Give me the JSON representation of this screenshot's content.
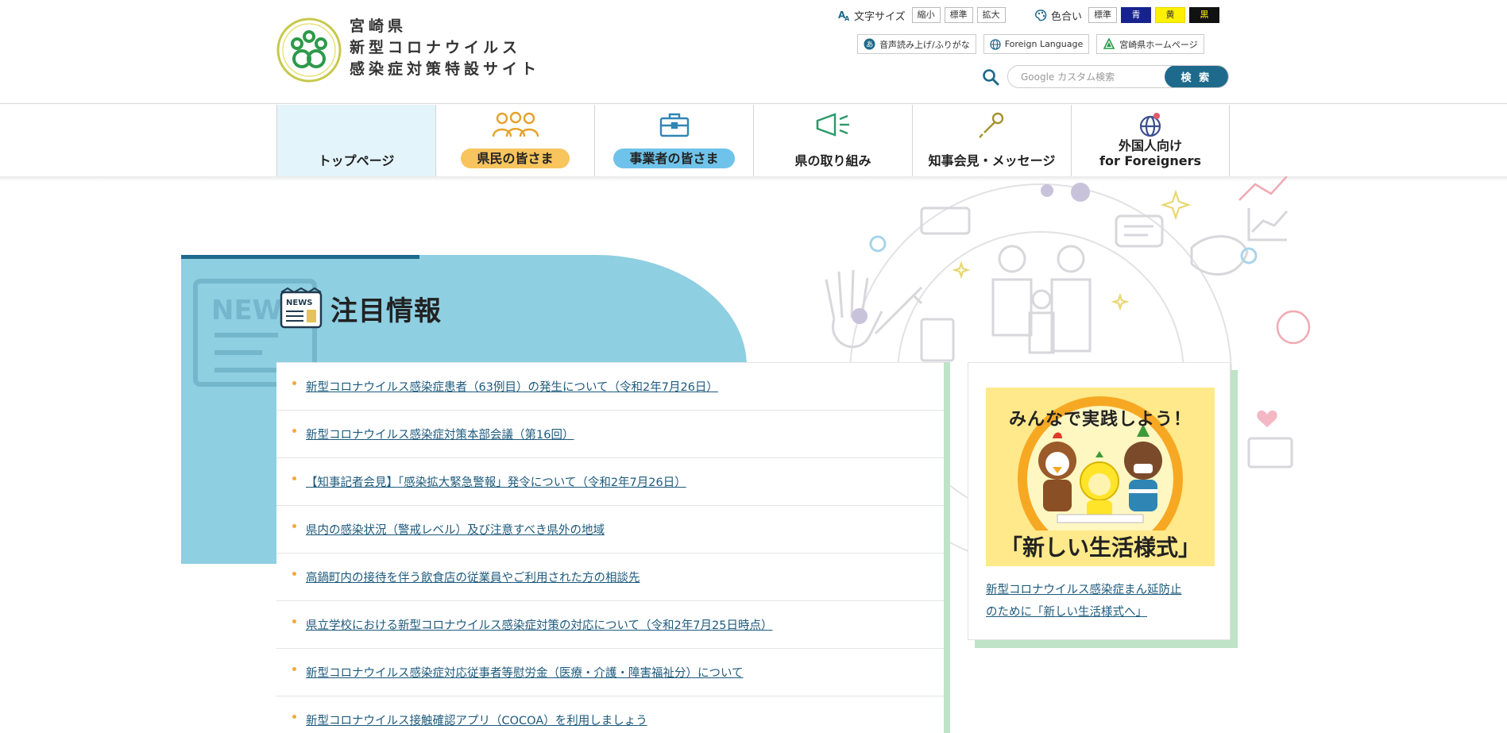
{
  "header": {
    "title_lines": [
      "宮崎県",
      "新型コロナウイルス",
      "感染症対策特設サイト"
    ],
    "font_size": {
      "label": "文字サイズ",
      "options": [
        "縮小",
        "標準",
        "拡大"
      ]
    },
    "color": {
      "label": "色合い",
      "options": [
        "標準",
        "青",
        "黄",
        "黒"
      ]
    },
    "links": {
      "reading": "音声読み上げ/ふりがな",
      "foreign": "Foreign Language",
      "pref_home": "宮崎県ホームページ"
    },
    "search": {
      "placeholder": "Google カスタム検索",
      "button": "検 索"
    }
  },
  "nav": {
    "items": [
      {
        "label": "トップページ"
      },
      {
        "label": "県民の皆さま"
      },
      {
        "label": "事業者の皆さま"
      },
      {
        "label": "県の取り組み"
      },
      {
        "label": "知事会見・メッセージ"
      },
      {
        "label_line1": "外国人向け",
        "label_line2": "for Foreigners"
      }
    ]
  },
  "section": {
    "icon_text": "NEWS",
    "title": "注目情報"
  },
  "news": [
    "新型コロナウイルス感染症患者（63例目）の発生について（令和2年7月26日）",
    "新型コロナウイルス感染症対策本部会議（第16回）",
    "【知事記者会見】「感染拡大緊急警報」発令について（令和2年7月26日）",
    "県内の感染状況（警戒レベル）及び注意すべき県外の地域",
    "高鍋町内の接待を伴う飲食店の従業員やご利用された方の相談先",
    "県立学校における新型コロナウイルス感染症対策の対応について（令和2年7月25日時点）",
    "新型コロナウイルス感染症対応従事者等慰労金（医療・介護・障害福祉分）について",
    "新型コロナウイルス接触確認アプリ（COCOA）を利用しましょう"
  ],
  "side": {
    "banner_top": "みんなで実践しよう！",
    "banner_bottom": "「新しい生活様式」",
    "link_line1": "新型コロナウイルス感染症まん延防止",
    "link_line2": "のために「新しい生活様式へ」"
  },
  "colors": {
    "accent": "#1e6a8c",
    "hero": "#8ecfe2",
    "pill_orange": "#f8c45e",
    "pill_blue": "#6fc3ea",
    "link": "#1d5a7c"
  }
}
